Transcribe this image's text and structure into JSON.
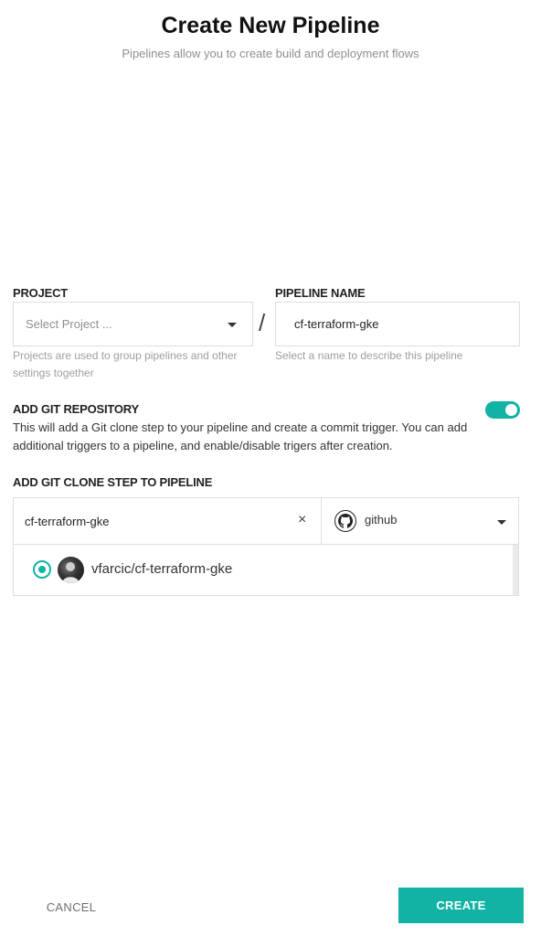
{
  "header": {
    "title": "Create New Pipeline",
    "subtitle": "Pipelines allow you to create build and deployment flows"
  },
  "project": {
    "label": "PROJECT",
    "placeholder": "Select Project ...",
    "help": "Projects are used to group pipelines and other settings together"
  },
  "separator": "/",
  "pipeline_name": {
    "label": "PIPELINE NAME",
    "value": "cf-terraform-gke",
    "help": "Select a name to describe this pipeline"
  },
  "git_repository": {
    "label": "ADD GIT REPOSITORY",
    "enabled": true,
    "description": "This will add a Git clone step to your pipeline and create a commit trigger. You can add additional triggers to a pipeline, and enable/disable trigers after creation."
  },
  "clone_step": {
    "label": "ADD GIT CLONE STEP TO PIPELINE",
    "search_value": "cf-terraform-gke",
    "clear_icon": "×",
    "provider": "github",
    "results": [
      {
        "name": "vfarcic/cf-terraform-gke",
        "selected": true
      }
    ]
  },
  "footer": {
    "cancel_label": "CANCEL",
    "create_label": "CREATE"
  },
  "colors": {
    "accent": "#12b3a5"
  }
}
